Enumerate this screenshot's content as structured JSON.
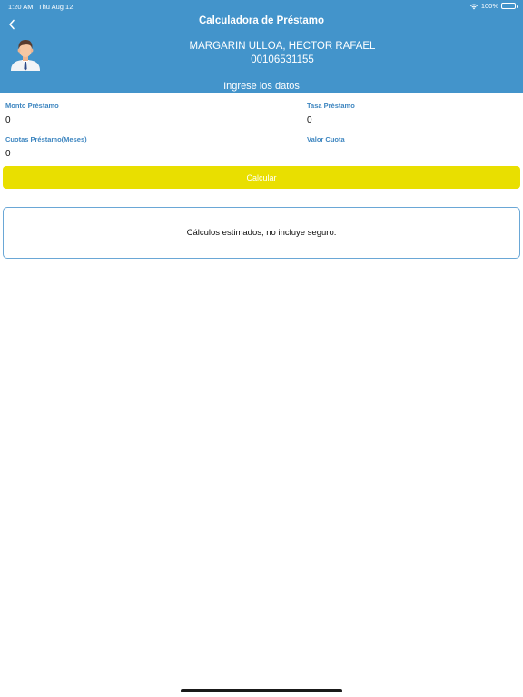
{
  "status_bar": {
    "time": "1:20 AM",
    "date": "Thu Aug 12",
    "battery": "100%",
    "wifi_icon": "wifi-icon",
    "battery_icon": "battery-icon"
  },
  "header": {
    "title": "Calculadora de Préstamo",
    "back_icon": "chevron-left-icon",
    "avatar_icon": "user-avatar-icon",
    "user_name": "MARGARIN ULLOA, HECTOR RAFAEL",
    "user_id": "00106531155",
    "section_title": "Ingrese los datos"
  },
  "form": {
    "monto": {
      "label": "Monto Préstamo",
      "value": "0"
    },
    "tasa": {
      "label": "Tasa Préstamo",
      "value": "0"
    },
    "cuotas": {
      "label": "Cuotas Préstamo(Meses)",
      "value": "0"
    },
    "valor_cuota": {
      "label": "Valor Cuota",
      "value": ""
    }
  },
  "actions": {
    "calculate_label": "Calcular"
  },
  "result": {
    "note": "Cálculos estimados, no incluye seguro."
  },
  "colors": {
    "header_bg": "#4394cb",
    "label": "#3e86c0",
    "button_bg": "#e9df00",
    "card_border": "#6aa7d6"
  }
}
